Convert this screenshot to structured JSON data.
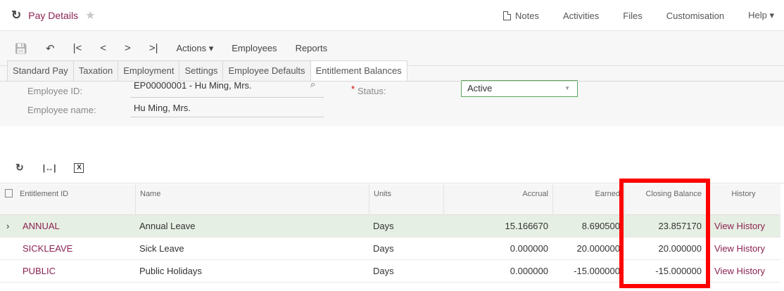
{
  "header": {
    "title": "Pay Details",
    "links": [
      "Notes",
      "Activities",
      "Files",
      "Customisation",
      "Help ▾"
    ]
  },
  "toolbar": {
    "actions_label": "Actions ▾",
    "employees_label": "Employees",
    "reports_label": "Reports"
  },
  "form": {
    "employee_id_label": "Employee ID:",
    "employee_id_value": "EP00000001 - Hu Ming, Mrs.",
    "employee_name_label": "Employee name:",
    "employee_name_value": "Hu Ming, Mrs.",
    "status_label": "Status:",
    "status_required": "*",
    "status_value": "Active"
  },
  "tabs": [
    "Standard Pay",
    "Taxation",
    "Employment",
    "Settings",
    "Employee Defaults",
    "Entitlement Balances"
  ],
  "grid": {
    "columns": [
      "Entitlement ID",
      "Name",
      "Units",
      "Accrual",
      "Earned",
      "Closing Balance",
      "History"
    ],
    "rows": [
      {
        "id": "ANNUAL",
        "name": "Annual Leave",
        "units": "Days",
        "accrual": "15.166670",
        "earned": "8.690500",
        "closing": "23.857170",
        "history": "View History"
      },
      {
        "id": "SICKLEAVE",
        "name": "Sick Leave",
        "units": "Days",
        "accrual": "0.000000",
        "earned": "20.000000",
        "closing": "20.000000",
        "history": "View History"
      },
      {
        "id": "PUBLIC",
        "name": "Public Holidays",
        "units": "Days",
        "accrual": "0.000000",
        "earned": "-15.000000",
        "closing": "-15.000000",
        "history": "View History"
      }
    ]
  },
  "colors": {
    "accent": "#8b2252",
    "highlight": "#ff0000",
    "selected_row": "#e6efe3",
    "status_border": "#5aa55a"
  }
}
